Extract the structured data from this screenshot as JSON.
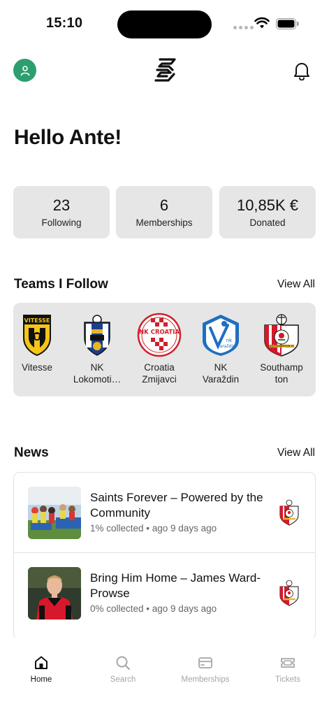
{
  "status_bar": {
    "time": "15:10"
  },
  "greeting": "Hello Ante!",
  "stats": [
    {
      "value": "23",
      "label": "Following"
    },
    {
      "value": "6",
      "label": "Memberships"
    },
    {
      "value": "10,85K €",
      "label": "Donated"
    }
  ],
  "teams_section": {
    "title": "Teams I Follow",
    "view_all": "View All",
    "teams": [
      {
        "name": "Vitesse"
      },
      {
        "name": "NK\nLokomoti…"
      },
      {
        "name": "Croatia\nZmijavci"
      },
      {
        "name": "NK\nVaraždin"
      },
      {
        "name": "Southamp\nton"
      }
    ]
  },
  "news_section": {
    "title": "News",
    "view_all": "View All",
    "items": [
      {
        "title": "Saints Forever – Powered by the Community",
        "meta": "1% collected • ago 9 days ago"
      },
      {
        "title": "Bring Him Home – James Ward-Prowse",
        "meta": "0% collected • ago 9 days ago"
      }
    ]
  },
  "tab_bar": {
    "tabs": [
      {
        "label": "Home",
        "icon": "home-icon",
        "active": true
      },
      {
        "label": "Search",
        "icon": "search-icon",
        "active": false
      },
      {
        "label": "Memberships",
        "icon": "card-icon",
        "active": false
      },
      {
        "label": "Tickets",
        "icon": "ticket-icon",
        "active": false
      }
    ]
  },
  "colors": {
    "accent": "#2e9e6e",
    "card_bg": "#e6e6e6",
    "muted": "#a5a5a5"
  }
}
